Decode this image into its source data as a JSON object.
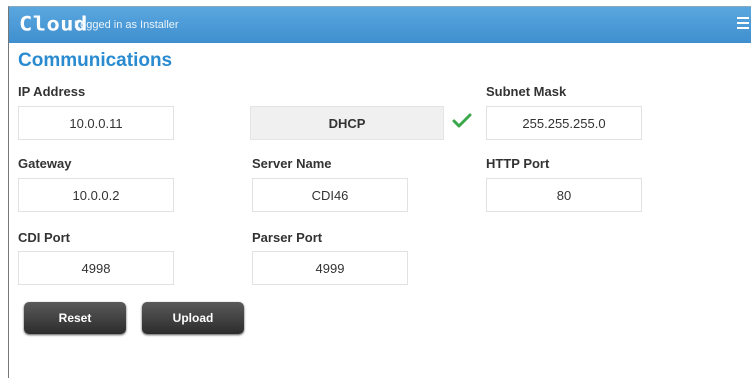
{
  "header": {
    "logo_text": "Cloud",
    "logged_in_text": "Logged in as Installer",
    "menu_icon": "hamburger-menu-icon"
  },
  "page": {
    "title": "Communications"
  },
  "fields": {
    "ip_address": {
      "label": "IP Address",
      "value": "10.0.0.11"
    },
    "dhcp": {
      "label": "DHCP",
      "checked": true
    },
    "subnet_mask": {
      "label": "Subnet Mask",
      "value": "255.255.255.0"
    },
    "gateway": {
      "label": "Gateway",
      "value": "10.0.0.2"
    },
    "server_name": {
      "label": "Server Name",
      "value": "CDI46"
    },
    "http_port": {
      "label": "HTTP Port",
      "value": "80"
    },
    "cdi_port": {
      "label": "CDI Port",
      "value": "4998"
    },
    "parser_port": {
      "label": "Parser Port",
      "value": "4999"
    }
  },
  "buttons": {
    "reset": "Reset",
    "upload": "Upload"
  },
  "colors": {
    "header_bg": "#4a9bd8",
    "title": "#2a8bd0",
    "check": "#3aa84a",
    "button_bg": "#3a3a3a"
  }
}
